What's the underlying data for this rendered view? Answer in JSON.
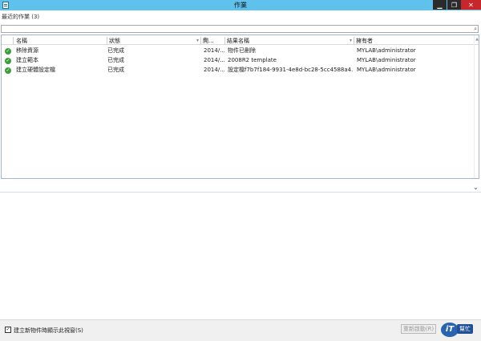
{
  "window": {
    "title": "作業",
    "minimize_label": "▁",
    "maximize_label": "❐",
    "close_label": "✕"
  },
  "recent_label": "最近的作業 (3)",
  "search": {
    "placeholder": "",
    "icon_glyph": "⌕"
  },
  "columns": [
    {
      "label": "名稱"
    },
    {
      "label": "狀態"
    },
    {
      "label": "開..."
    },
    {
      "label": "結果名稱"
    },
    {
      "label": "擁有者"
    }
  ],
  "rows": [
    {
      "name": "移除資源",
      "status": "已完成",
      "started": "2014/...",
      "result": "物件已刪除",
      "owner": "MYLAB\\administrator"
    },
    {
      "name": "建立範本",
      "status": "已完成",
      "started": "2014/...",
      "result": "2008R2 template",
      "owner": "MYLAB\\administrator"
    },
    {
      "name": "建立硬體設定檔",
      "status": "已完成",
      "started": "2014/...",
      "result": "設定檔f7b7f184-9931-4e8d-bc28-5cc4588a4...",
      "owner": "MYLAB\\administrator"
    }
  ],
  "footer": {
    "checkbox_checked": true,
    "checkbox_label": "建立新物件時顯示此視窗(S)",
    "restart_label": "重新啟動(R)"
  },
  "logo": {
    "badge_text": "iT",
    "text": "幫忙"
  },
  "colors": {
    "titlebar": "#5fc2ec",
    "success": "#3c9d3a",
    "close": "#c7262c"
  }
}
